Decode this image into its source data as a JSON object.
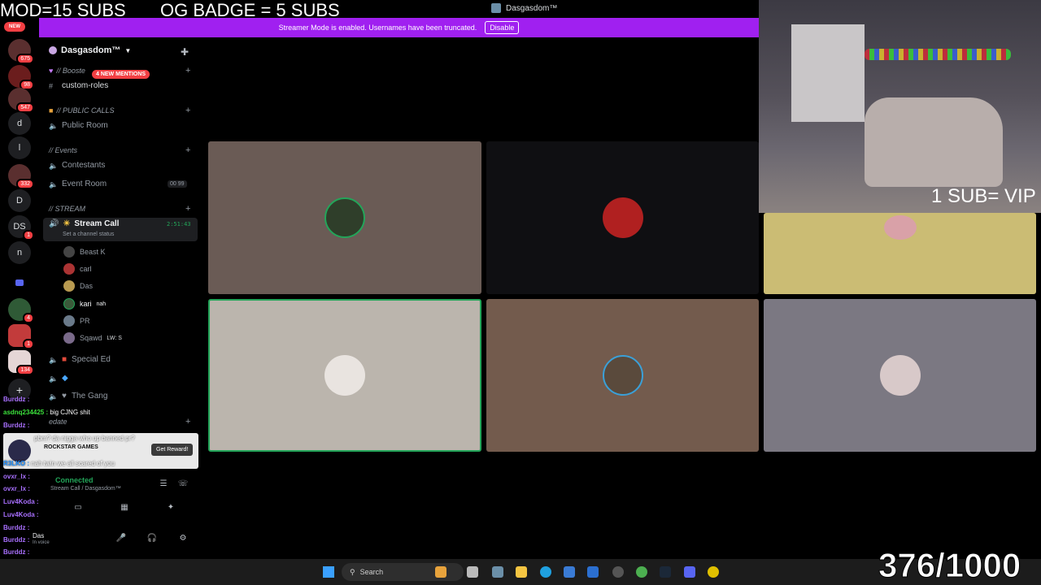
{
  "overlay": {
    "mod_text": "MOD=15 SUBS",
    "og_text": "OG BADGE = 5 SUBS",
    "vip_text": "1 SUB= VIP",
    "sub_count": "376/1000"
  },
  "window": {
    "title": "Dasgasdom™"
  },
  "banner": {
    "message": "Streamer Mode is enabled. Usernames have been truncated.",
    "disable_label": "Disable",
    "color": "#a020f0"
  },
  "rail": {
    "new_label": "NEW",
    "servers": [
      {
        "label": "",
        "badge": "675"
      },
      {
        "label": "",
        "badge": "98"
      },
      {
        "label": "",
        "badge": "547"
      },
      {
        "label": "d",
        "badge": ""
      },
      {
        "label": "l",
        "badge": ""
      },
      {
        "label": "",
        "badge": "332"
      },
      {
        "label": "D",
        "badge": ""
      },
      {
        "label": "DS",
        "badge": "1"
      },
      {
        "label": "n",
        "badge": ""
      },
      {
        "label": "",
        "badge": ""
      },
      {
        "label": "",
        "badge": "4"
      },
      {
        "label": "",
        "badge": "1"
      },
      {
        "label": "",
        "badge": "134"
      }
    ]
  },
  "sidebar": {
    "server_name": "Dasgasdom™",
    "mentions_pill": "4 NEW MENTIONS",
    "categories": {
      "boosters": "// Booste",
      "public_calls": "// PUBLIC CALLS",
      "events": "// Events",
      "stream": "// STREAM",
      "edate": "edate"
    },
    "channels": {
      "custom_roles": "custom-roles",
      "public_room": "Public Room",
      "contestants": "Contestants",
      "event_room": "Event Room",
      "event_counter": "00  99",
      "stream_call": "Stream Call",
      "stream_time": "2:51:43",
      "stream_status": "Set a channel status",
      "special_ed": "Special Ed",
      "the_gang": "The Gang"
    },
    "members": [
      {
        "name": "Beast K",
        "extra": ""
      },
      {
        "name": "carl",
        "extra": ""
      },
      {
        "name": "Das",
        "extra": ""
      },
      {
        "name": "kari",
        "extra": "nah"
      },
      {
        "name": "PR",
        "extra": ""
      },
      {
        "name": "Sqawd",
        "extra": "LW: S"
      }
    ]
  },
  "chat": {
    "lines": [
      {
        "user": "Burddz :",
        "text": ""
      },
      {
        "user": "asdnq234425 :",
        "text": "big CJNG shit"
      },
      {
        "user": "Burddz :",
        "text": ""
      },
      {
        "user": "",
        "text": "pbm? da nigga who up banned pr?"
      },
      {
        "user": "R3LKO :",
        "text": "nah twin we all scared of you"
      },
      {
        "user": "ovxr_lx :",
        "text": ""
      },
      {
        "user": "ovxr_lx :",
        "text": ""
      },
      {
        "user": "Luv4Koda :",
        "text": ""
      },
      {
        "user": "Luv4Koda :",
        "text": ""
      },
      {
        "user": "Burddz :",
        "text": ""
      },
      {
        "user": "Burddz :",
        "text": ""
      },
      {
        "user": "Burddz :",
        "text": ""
      }
    ],
    "reward_brand": "ROCKSTAR GAMES",
    "reward_button": "Get Reward!"
  },
  "voice": {
    "status": "Connected",
    "location": "Stream Call / Dasgasdom™",
    "user_label": "Das",
    "user_sub": "In voice"
  },
  "taskbar": {
    "search_placeholder": "Search"
  },
  "colors": {
    "connected_green": "#23a559",
    "badge_red": "#f23f43",
    "discord_blurple": "#5865f2"
  }
}
